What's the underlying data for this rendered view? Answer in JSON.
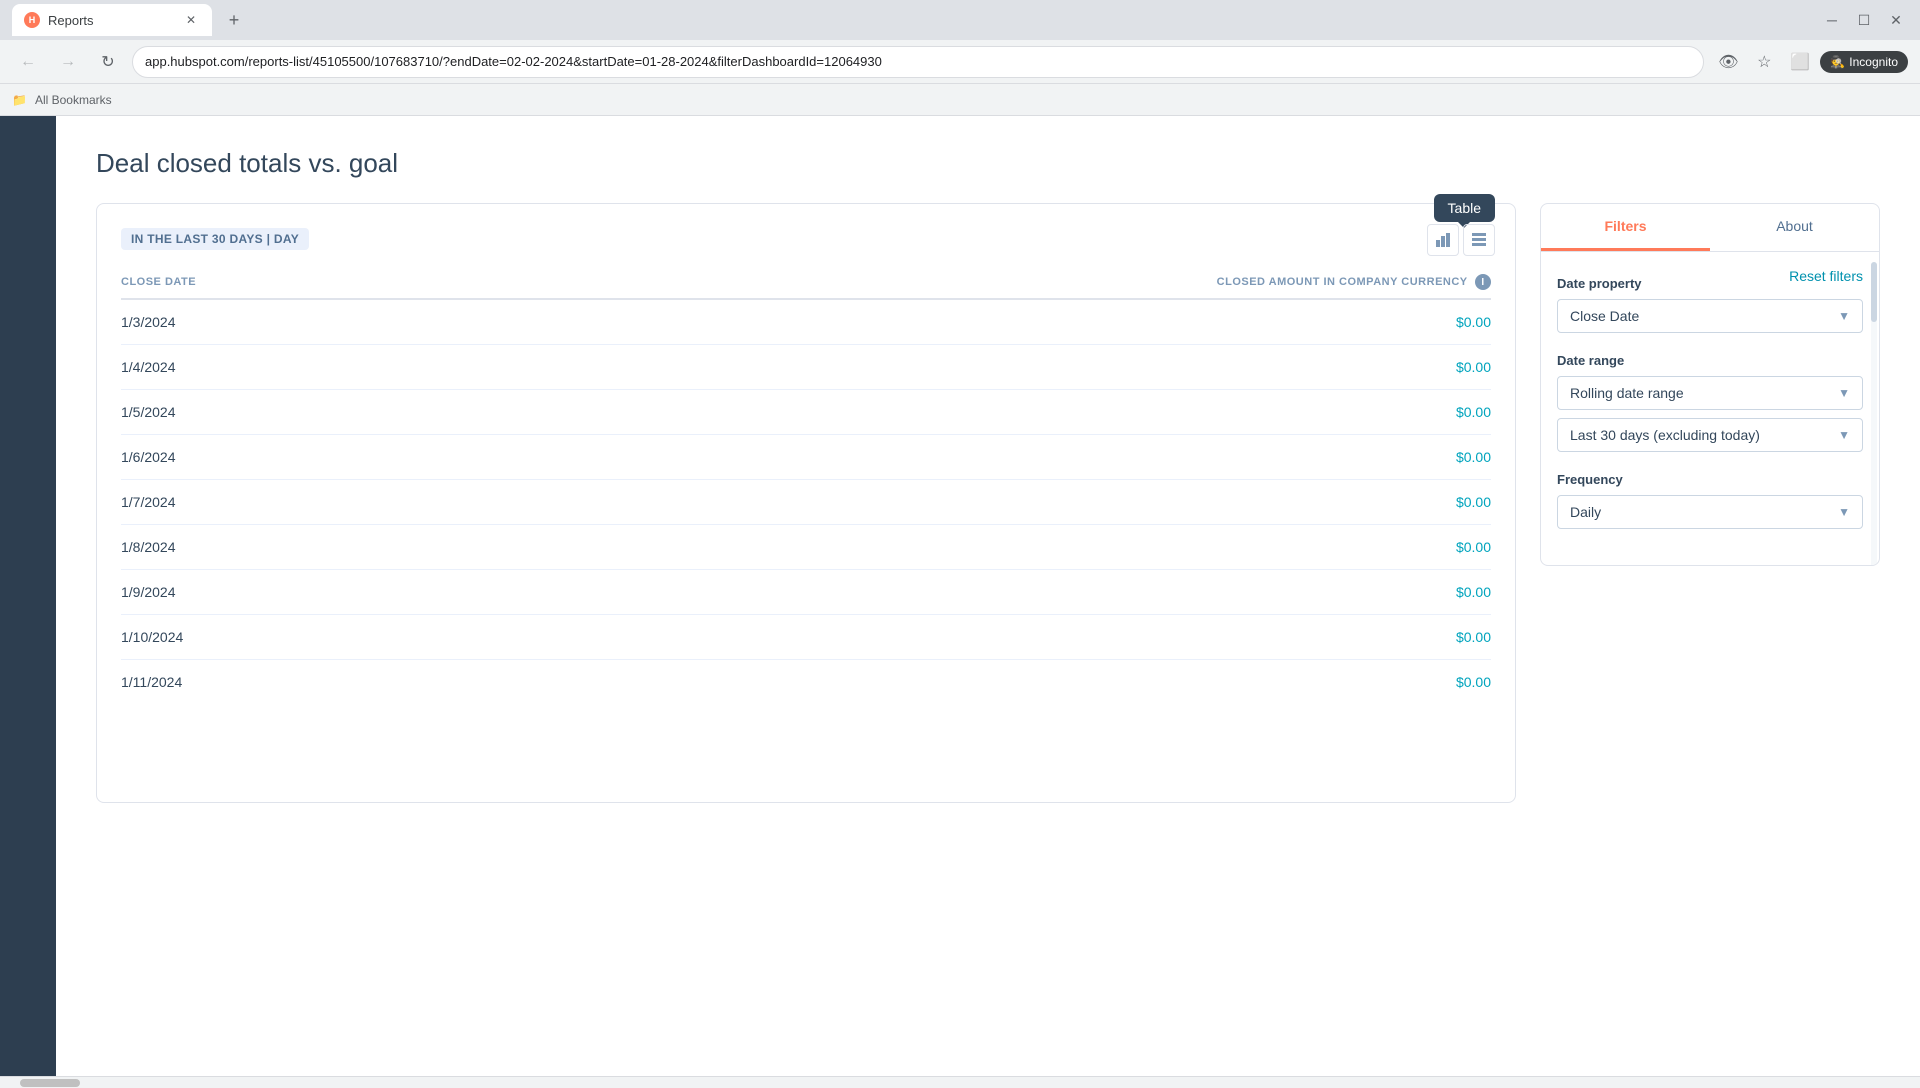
{
  "browser": {
    "tab_title": "Reports",
    "tab_favicon": "H",
    "url": "app.hubspot.com/reports-list/45105500/107683710/?endDate=02-02-2024&startDate=01-28-2024&filterDashboardId=12064930",
    "incognito_label": "Incognito",
    "bookmarks_label": "All Bookmarks"
  },
  "page": {
    "title": "Deal closed totals vs. goal"
  },
  "report": {
    "view_tooltip": "Table",
    "date_badge": "IN THE LAST 30 DAYS | DAY",
    "table": {
      "columns": [
        {
          "id": "close_date",
          "label": "CLOSE DATE",
          "align": "left"
        },
        {
          "id": "amount",
          "label": "CLOSED AMOUNT IN COMPANY CURRENCY",
          "align": "right",
          "info": true
        }
      ],
      "rows": [
        {
          "date": "1/3/2024",
          "amount": "$0.00"
        },
        {
          "date": "1/4/2024",
          "amount": "$0.00"
        },
        {
          "date": "1/5/2024",
          "amount": "$0.00"
        },
        {
          "date": "1/6/2024",
          "amount": "$0.00"
        },
        {
          "date": "1/7/2024",
          "amount": "$0.00"
        },
        {
          "date": "1/8/2024",
          "amount": "$0.00"
        },
        {
          "date": "1/9/2024",
          "amount": "$0.00"
        },
        {
          "date": "1/10/2024",
          "amount": "$0.00"
        },
        {
          "date": "1/11/2024",
          "amount": "$0.00"
        }
      ]
    }
  },
  "filters_panel": {
    "tabs": [
      {
        "id": "filters",
        "label": "Filters",
        "active": true
      },
      {
        "id": "about",
        "label": "About",
        "active": false
      }
    ],
    "reset_label": "Reset filters",
    "date_property": {
      "label": "Date property",
      "value": "Close Date"
    },
    "date_range": {
      "label": "Date range",
      "value": "Rolling date range"
    },
    "date_range_sub": {
      "value": "Last 30 days (excluding today)"
    },
    "frequency": {
      "label": "Frequency",
      "value": "Daily"
    }
  }
}
